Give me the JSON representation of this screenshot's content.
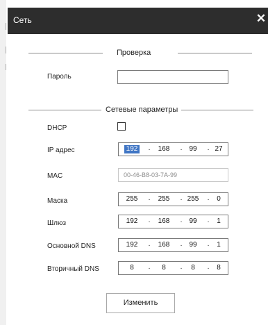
{
  "window": {
    "title": "Сеть",
    "close_icon": "close-icon"
  },
  "verification": {
    "section_title": "Проверка",
    "password_label": "Пароль",
    "password_value": ""
  },
  "network": {
    "section_title": "Сетевые параметры",
    "dhcp": {
      "label": "DHCP",
      "checked": false
    },
    "ip_address": {
      "label": "IP адрес",
      "octets": [
        "192",
        "168",
        "99",
        "27"
      ],
      "selected_octet": "192"
    },
    "mac": {
      "label": "MAC",
      "value": "00-46-B8-03-7A-99"
    },
    "mask": {
      "label": "Маска",
      "octets": [
        "255",
        "255",
        "255",
        "0"
      ]
    },
    "gateway": {
      "label": "Шлюз",
      "octets": [
        "192",
        "168",
        "99",
        "1"
      ]
    },
    "primary_dns": {
      "label": "Основной DNS",
      "octets": [
        "192",
        "168",
        "99",
        "1"
      ]
    },
    "secondary_dns": {
      "label": "Вторичный DNS",
      "octets": [
        "8",
        "8",
        "8",
        "8"
      ]
    },
    "separator": "."
  },
  "actions": {
    "change_label": "Изменить"
  },
  "colors": {
    "titlebar": "#2d2d2d",
    "selection": "#3f75c4"
  }
}
